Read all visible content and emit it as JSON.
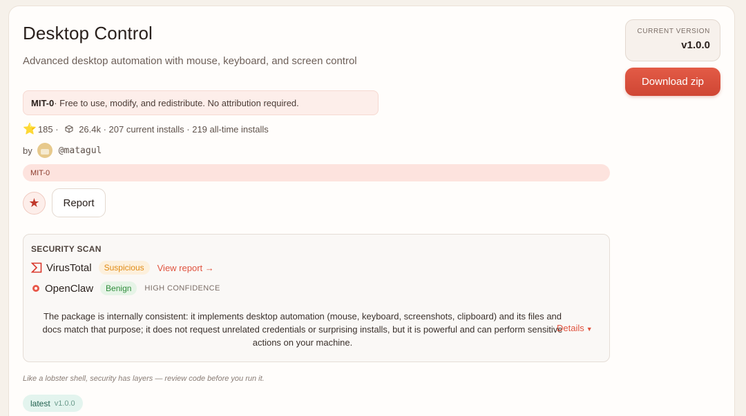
{
  "skill": {
    "title": "Desktop Control",
    "subtitle": "Advanced desktop automation with mouse, keyboard, and screen control"
  },
  "license_box": {
    "name": "MIT-0",
    "text": " · Free to use, modify, and redistribute. No attribution required."
  },
  "stats": {
    "stars": "185",
    "stars_sep": " · ",
    "downloads": "26.4k",
    "installs": " · 207 current installs · 219 all-time installs"
  },
  "author": {
    "by_label": "by",
    "handle": "@matagul"
  },
  "license_tag": "MIT-0",
  "actions": {
    "star_glyph": "★",
    "report_label": "Report"
  },
  "security": {
    "title": "SECURITY SCAN",
    "virustotal": {
      "name": "VirusTotal",
      "status": "Suspicious",
      "link": "View report →"
    },
    "openclaw": {
      "name": "OpenClaw",
      "status": "Benign",
      "confidence": "HIGH CONFIDENCE"
    },
    "description": "The package is internally consistent: it implements desktop automation (mouse, keyboard, screenshots, clipboard) and its files and docs match that purpose; it does not request unrelated credentials or surprising installs, but it is powerful and can perform sensitive actions on your machine.",
    "details_label": "Details"
  },
  "tagline": "Like a lobster shell, security has layers — review code before you run it.",
  "version_tag": {
    "label": "latest",
    "version": "v1.0.0"
  },
  "sidebar": {
    "current_version_label": "CURRENT VERSION",
    "current_version": "v1.0.0",
    "download_label": "Download zip"
  },
  "colors": {
    "accent": "#e0533f",
    "suspicious": "#e08a14",
    "benign": "#2f8d3b"
  }
}
